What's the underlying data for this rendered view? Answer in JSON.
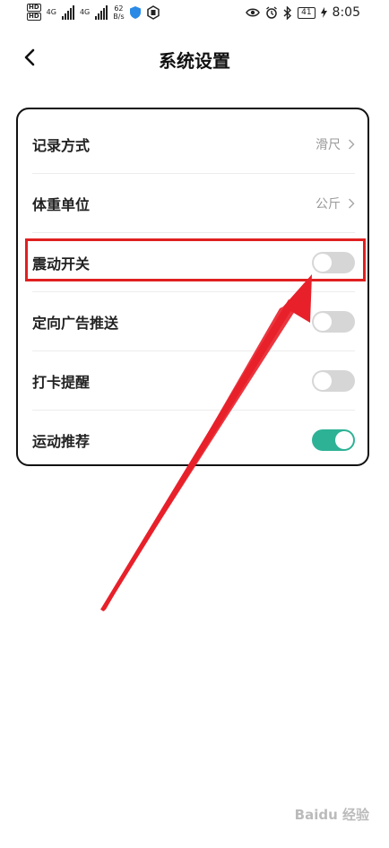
{
  "status_bar": {
    "hd_badges": [
      "HD",
      "HD"
    ],
    "signal_labels": [
      "4G",
      "4G"
    ],
    "net_speed": "62",
    "net_unit": "B/s",
    "battery": "41",
    "time": "8:05"
  },
  "header": {
    "title": "系统设置"
  },
  "settings": {
    "rows": [
      {
        "label": "记录方式",
        "value": "滑尺"
      },
      {
        "label": "体重单位",
        "value": "公斤"
      },
      {
        "label": "震动开关",
        "enabled": false
      },
      {
        "label": "定向广告推送",
        "enabled": false
      },
      {
        "label": "打卡提醒",
        "enabled": false
      },
      {
        "label": "运动推荐",
        "enabled": true
      }
    ]
  },
  "colors": {
    "toggle_on": "#2db295",
    "toggle_off": "#d6d6d6",
    "annotation": "#e02020"
  },
  "watermark": "Baidu 经验"
}
